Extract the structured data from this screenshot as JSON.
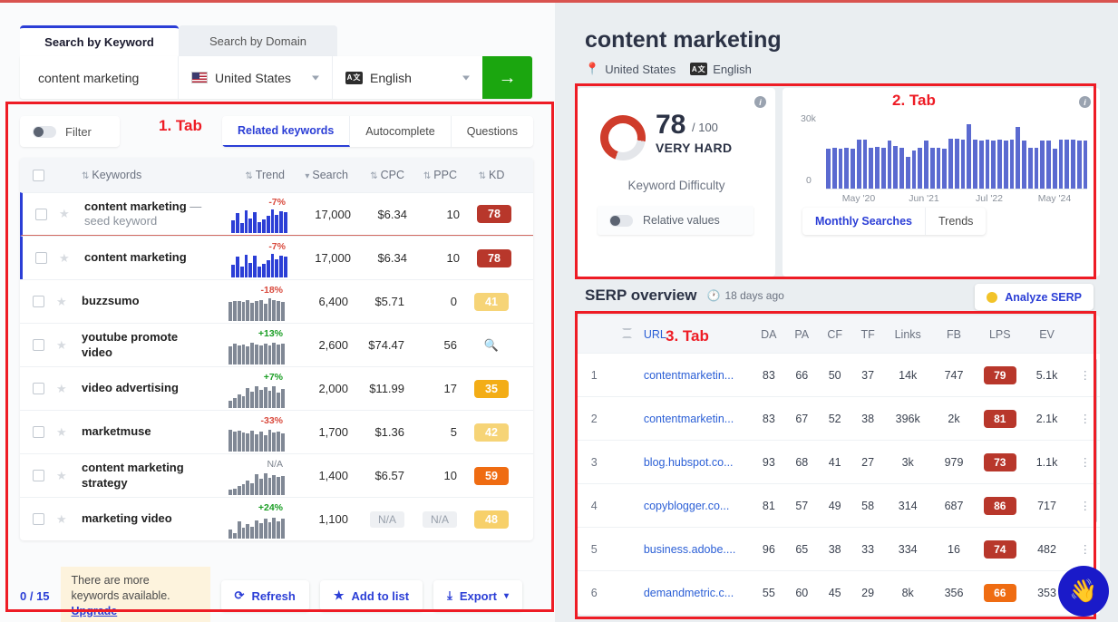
{
  "annotations": {
    "tab1": "1. Tab",
    "tab2": "2. Tab",
    "tab3": "3. Tab"
  },
  "left": {
    "main_tabs": [
      {
        "label": "Search by Keyword",
        "active": true
      },
      {
        "label": "Search by Domain",
        "active": false
      }
    ],
    "search": {
      "query": "content marketing",
      "country": "United States",
      "language": "English",
      "submit_icon": "arrow-right-icon"
    },
    "filter_label": "Filter",
    "keyword_tabs": [
      {
        "label": "Related keywords",
        "active": true
      },
      {
        "label": "Autocomplete",
        "active": false
      },
      {
        "label": "Questions",
        "active": false
      }
    ],
    "table_headers": {
      "keywords": "Keywords",
      "trend": "Trend",
      "search": "Search",
      "cpc": "CPC",
      "ppc": "PPC",
      "kd": "KD"
    },
    "rows": [
      {
        "keyword": "content marketing",
        "suffix": "—",
        "subtitle": "seed keyword",
        "trend": "-7%",
        "trend_dir": "down",
        "search": "17,000",
        "cpc": "$6.34",
        "ppc": "10",
        "kd": "78",
        "kd_color": "#b8372b",
        "seed": true,
        "spark": [
          52,
          86,
          44,
          96,
          60,
          90,
          46,
          56,
          72,
          100,
          76,
          92,
          88
        ]
      },
      {
        "keyword": "content marketing",
        "suffix": "",
        "subtitle": "",
        "trend": "-7%",
        "trend_dir": "down",
        "search": "17,000",
        "cpc": "$6.34",
        "ppc": "10",
        "kd": "78",
        "kd_color": "#b8372b",
        "seed": false,
        "marked": true,
        "spark": [
          52,
          86,
          44,
          96,
          60,
          90,
          46,
          56,
          72,
          100,
          76,
          92,
          88
        ]
      },
      {
        "keyword": "buzzsumo",
        "suffix": "",
        "subtitle": "",
        "trend": "-18%",
        "trend_dir": "down",
        "search": "6,400",
        "cpc": "$5.71",
        "ppc": "0",
        "kd": "41",
        "kd_color": "#f6d477",
        "gray": true,
        "spark": [
          78,
          82,
          84,
          80,
          88,
          76,
          84,
          86,
          72,
          96,
          88,
          84,
          80
        ]
      },
      {
        "keyword": "youtube promote",
        "suffix": "",
        "subtitle": "video",
        "trend": "+13%",
        "trend_dir": "up",
        "search": "2,600",
        "cpc": "$74.47",
        "ppc": "56",
        "kd": "search-icon",
        "kd_is_icon": true,
        "gray": true,
        "spark": [
          74,
          88,
          80,
          84,
          76,
          90,
          82,
          78,
          86,
          80,
          92,
          84,
          88
        ]
      },
      {
        "keyword": "video advertising",
        "suffix": "",
        "subtitle": "",
        "trend": "+7%",
        "trend_dir": "up",
        "search": "2,000",
        "cpc": "$11.99",
        "ppc": "17",
        "kd": "35",
        "kd_color": "#f3ad16",
        "gray": true,
        "spark": [
          30,
          42,
          56,
          48,
          82,
          66,
          92,
          74,
          86,
          70,
          90,
          64,
          80
        ]
      },
      {
        "keyword": "marketmuse",
        "suffix": "",
        "subtitle": "",
        "trend": "-33%",
        "trend_dir": "down",
        "search": "1,700",
        "cpc": "$1.36",
        "ppc": "5",
        "kd": "42",
        "kd_color": "#f6d477",
        "gray": true,
        "spark": [
          90,
          84,
          86,
          80,
          76,
          88,
          72,
          84,
          66,
          90,
          78,
          82,
          74
        ]
      },
      {
        "keyword": "content marketing",
        "suffix": "",
        "subtitle": "strategy",
        "trend": "N/A",
        "trend_dir": "na",
        "search": "1,400",
        "cpc": "$6.57",
        "ppc": "10",
        "kd": "59",
        "kd_color": "#ef6c12",
        "gray": true,
        "spark": [
          20,
          26,
          38,
          44,
          60,
          50,
          88,
          66,
          92,
          70,
          84,
          76,
          80
        ]
      },
      {
        "keyword": "marketing video",
        "suffix": "",
        "subtitle": "",
        "trend": "+24%",
        "trend_dir": "up",
        "search": "1,100",
        "cpc": "N/A",
        "cpc_na": true,
        "ppc": "N/A",
        "ppc_na": true,
        "kd": "48",
        "kd_color": "#f7d06a",
        "gray": true,
        "spark": [
          36,
          22,
          70,
          44,
          58,
          50,
          76,
          62,
          84,
          68,
          86,
          72,
          82
        ]
      }
    ],
    "footer": {
      "counter": "0 / 15",
      "upgrade_text": "There are more keywords available.",
      "upgrade_link": "Upgrade",
      "refresh": "Refresh",
      "add_to_list": "Add to list",
      "export": "Export"
    }
  },
  "right": {
    "title": "content marketing",
    "country": "United States",
    "language": "English",
    "kd_card": {
      "value": "78",
      "max": "/ 100",
      "verdict": "VERY HARD",
      "caption": "Keyword Difficulty",
      "relative_values": "Relative values",
      "ring_color": "#cf3c2b",
      "percent": 78
    },
    "ms_card": {
      "y_top": "30k",
      "y_bottom": "0",
      "x_labels": [
        "May '20",
        "Jun '21",
        "Jul '22",
        "May '24"
      ],
      "tabs": [
        {
          "label": "Monthly Searches",
          "active": true
        },
        {
          "label": "Trends",
          "active": false
        }
      ]
    },
    "serp": {
      "title": "SERP overview",
      "updated": "18 days ago",
      "analyze_button": "Analyze SERP",
      "headers": [
        "URL",
        "DA",
        "PA",
        "CF",
        "TF",
        "Links",
        "FB",
        "LPS",
        "EV"
      ],
      "rows": [
        {
          "rank": "1",
          "url": "contentmarketin...",
          "da": "83",
          "pa": "66",
          "cf": "50",
          "tf": "37",
          "links": "14k",
          "fb": "747",
          "lps": "79",
          "lps_color": "#b8372b",
          "ev": "5.1k"
        },
        {
          "rank": "2",
          "url": "contentmarketin...",
          "da": "83",
          "pa": "67",
          "cf": "52",
          "tf": "38",
          "links": "396k",
          "fb": "2k",
          "lps": "81",
          "lps_color": "#b8372b",
          "ev": "2.1k"
        },
        {
          "rank": "3",
          "url": "blog.hubspot.co...",
          "da": "93",
          "pa": "68",
          "cf": "41",
          "tf": "27",
          "links": "3k",
          "fb": "979",
          "lps": "73",
          "lps_color": "#b8372b",
          "ev": "1.1k"
        },
        {
          "rank": "4",
          "url": "copyblogger.co...",
          "da": "81",
          "pa": "57",
          "cf": "49",
          "tf": "58",
          "links": "314",
          "fb": "687",
          "lps": "86",
          "lps_color": "#b8372b",
          "ev": "717"
        },
        {
          "rank": "5",
          "url": "business.adobe....",
          "da": "96",
          "pa": "65",
          "cf": "38",
          "tf": "33",
          "links": "334",
          "fb": "16",
          "lps": "74",
          "lps_color": "#b8372b",
          "ev": "482"
        },
        {
          "rank": "6",
          "url": "demandmetric.c...",
          "da": "55",
          "pa": "60",
          "cf": "45",
          "tf": "29",
          "links": "8k",
          "fb": "356",
          "lps": "66",
          "lps_color": "#ef6c12",
          "ev": "353"
        }
      ]
    },
    "chat_button_icon": "waving-hand-icon"
  },
  "chart_data": {
    "type": "bar",
    "title": "Monthly Searches",
    "xlabel": "",
    "ylabel": "",
    "ylim": [
      0,
      30000
    ],
    "ytick_labels": [
      "0",
      "30k"
    ],
    "x_tick_labels": [
      "May '20",
      "Jun '21",
      "Jul '22",
      "May '24"
    ],
    "values": [
      17000,
      17500,
      17000,
      17500,
      17000,
      21000,
      21000,
      17500,
      18000,
      17500,
      20500,
      18500,
      17500,
      13500,
      16500,
      17500,
      20500,
      17500,
      17500,
      17000,
      21500,
      21500,
      21000,
      27500,
      21000,
      20500,
      21000,
      20500,
      21000,
      20500,
      21000,
      26500,
      20500,
      17500,
      17500,
      20500,
      20500,
      17000,
      21000,
      21000,
      21000,
      20500,
      20500
    ],
    "grid": false,
    "legend": false,
    "bar_color": "#5b6ad0"
  }
}
